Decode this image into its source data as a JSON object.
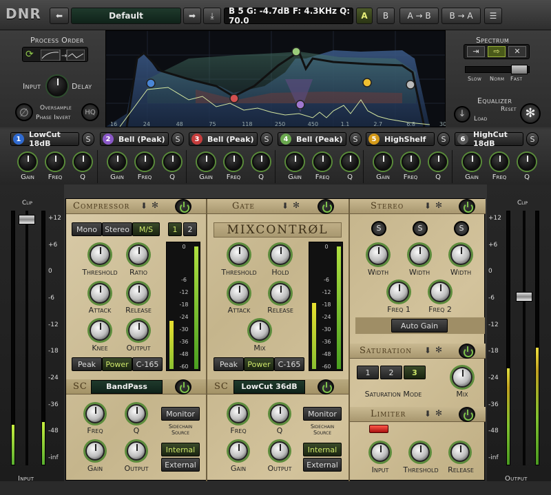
{
  "app": {
    "logo": "DNR"
  },
  "toolbar": {
    "preset": "Default",
    "band_info": "B 5 G: -4.7dB F: 4.3KHz Q: 70.0",
    "ab_a": "A",
    "ab_b": "B",
    "copy_ab": "A → B",
    "copy_ba": "B → A"
  },
  "process_order": {
    "title": "Process Order"
  },
  "io": {
    "input_label": "Input",
    "delay_label": "Delay",
    "oversample": "Oversample",
    "phase_invert": "Phase Invert",
    "hq": "HQ"
  },
  "spectrum": {
    "title": "Spectrum",
    "slow": "Slow",
    "norm": "Norm",
    "fast": "Fast"
  },
  "equalizer": {
    "title": "Equalizer",
    "reset": "Reset",
    "load": "Load"
  },
  "freq_axis": [
    "16",
    "24",
    "48",
    "75",
    "118",
    "250",
    "450",
    "1.1",
    "2.7",
    "6.8",
    "30"
  ],
  "bands": [
    {
      "num": "1",
      "type": "LowCut 18dB",
      "color": "#2f6ad0",
      "s": "S"
    },
    {
      "num": "2",
      "type": "Bell (Peak)",
      "color": "#8a58c8",
      "s": "S"
    },
    {
      "num": "3",
      "type": "Bell (Peak)",
      "color": "#c63d3d",
      "s": "S"
    },
    {
      "num": "4",
      "type": "Bell (Peak)",
      "color": "#6aa84f",
      "s": "S"
    },
    {
      "num": "5",
      "type": "HighShelf",
      "color": "#d49a1a",
      "s": "S"
    },
    {
      "num": "6",
      "type": "HighCut 18dB",
      "color": "#555555",
      "s": "S"
    }
  ],
  "band_knobs": {
    "gain": "Gain",
    "freq": "Freq",
    "q": "Q"
  },
  "compressor": {
    "title": "Compressor",
    "mono": "Mono",
    "stereo": "Stereo",
    "ms": "M/S",
    "ch1": "1",
    "ch2": "2",
    "threshold": "Threshold",
    "ratio": "Ratio",
    "attack": "Attack",
    "release": "Release",
    "knee": "Knee",
    "output": "Output",
    "peak": "Peak",
    "power": "Power",
    "c165": "C-165",
    "sc": "SC",
    "sc_filter": "BandPass",
    "sc_freq": "Freq",
    "sc_q": "Q",
    "sc_gain": "Gain",
    "sc_output": "Output",
    "monitor": "Monitor",
    "sidechain_source": "Sidechain\nSource",
    "internal": "Internal",
    "external": "External"
  },
  "gate": {
    "title": "Gate",
    "logo": "MIXCONTRØL",
    "threshold": "Threshold",
    "hold": "Hold",
    "attack": "Attack",
    "release": "Release",
    "mix": "Mix",
    "peak": "Peak",
    "power": "Power",
    "c165": "C-165",
    "sc": "SC",
    "sc_filter": "LowCut 36dB",
    "sc_freq": "Freq",
    "sc_q": "Q",
    "sc_gain": "Gain",
    "sc_output": "Output",
    "monitor": "Monitor",
    "sidechain_source": "Sidechain\nSource",
    "internal": "Internal",
    "external": "External"
  },
  "meter_scale": [
    "0",
    "-6",
    "-12",
    "-18",
    "-24",
    "-30",
    "-36",
    "-48",
    "-60"
  ],
  "stereo": {
    "title": "Stereo",
    "s": "S",
    "width": "Width",
    "freq1": "Freq 1",
    "freq2": "Freq 2",
    "auto_gain": "Auto Gain"
  },
  "saturation": {
    "title": "Saturation",
    "m1": "1",
    "m2": "2",
    "m3": "3",
    "mode_label": "Saturation Mode",
    "mix": "Mix"
  },
  "limiter": {
    "title": "Limiter",
    "input": "Input",
    "threshold": "Threshold",
    "release": "Release"
  },
  "side_meters": {
    "clip": "Clip",
    "input": "Input",
    "output": "Output",
    "scale": [
      "+12",
      "+6",
      "0",
      "-6",
      "-12",
      "-18",
      "-24",
      "-36",
      "-48",
      "-inf"
    ]
  }
}
